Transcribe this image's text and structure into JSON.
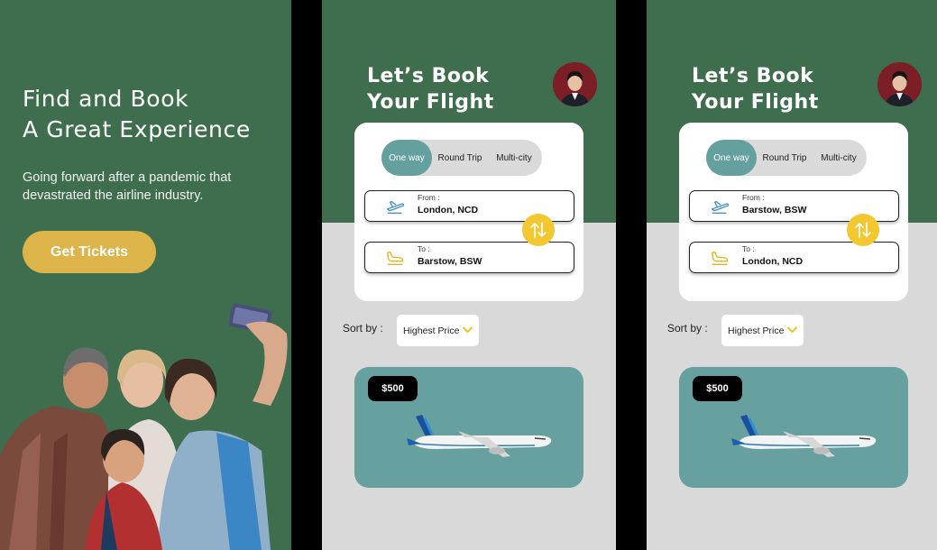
{
  "promo": {
    "title": "Find and Book\nA Great Experience",
    "subtitle": "Going forward after a pandemic that devastrated the airline industry.",
    "cta_label": "Get Tickets"
  },
  "colors": {
    "green": "#3e6e4d",
    "accent_gold": "#ddb44a",
    "swap_yellow": "#f3c72f",
    "teal": "#64a09e",
    "screen_bg": "#d9d9d9"
  },
  "screens": [
    {
      "title": "Let’s Book Your Flight",
      "trip_types": [
        "One way",
        "Round Trip",
        "Multi-city"
      ],
      "active_trip": "One way",
      "from_label": "From :",
      "from_value": "London, NCD",
      "to_label": "To :",
      "to_value": "Barstow, BSW",
      "sort_label": "Sort by :",
      "sort_value": "Highest Price",
      "price": "$500"
    },
    {
      "title": "Let’s Book Your Flight",
      "trip_types": [
        "One way",
        "Round Trip",
        "Multi-city"
      ],
      "active_trip": "One way",
      "from_label": "From :",
      "from_value": "Barstow, BSW",
      "to_label": "To :",
      "to_value": "London, NCD",
      "sort_label": "Sort by :",
      "sort_value": "Highest Price",
      "price": "$500"
    }
  ]
}
